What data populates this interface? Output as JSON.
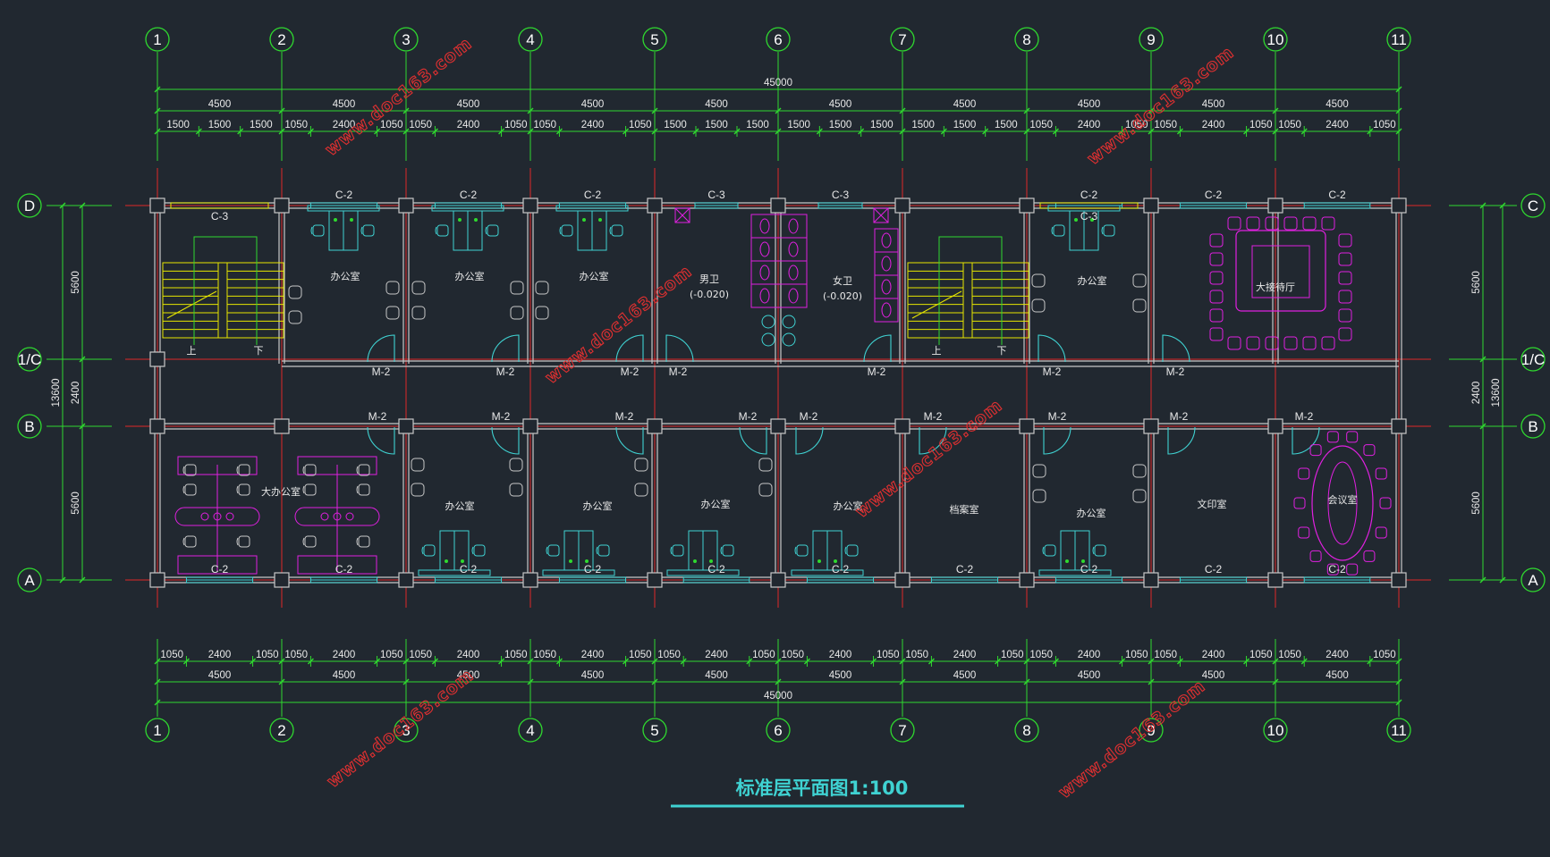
{
  "title": "标准层平面图1:100",
  "watermark": "www.doc163.com",
  "grid_x_labels": [
    "1",
    "2",
    "3",
    "4",
    "5",
    "6",
    "7",
    "8",
    "9",
    "10",
    "11"
  ],
  "grid_y_left": [
    "D",
    "1/C",
    "B",
    "A"
  ],
  "grid_y_right": [
    "C",
    "1/C",
    "B",
    "A"
  ],
  "dims_top_total": "45000",
  "dims_top_bays": [
    "4500",
    "4500",
    "4500",
    "4500",
    "4500",
    "4500",
    "4500",
    "4500",
    "4500",
    "4500"
  ],
  "dims_top_detail": [
    "1500",
    "1500",
    "1500",
    "1050",
    "2400",
    "1050",
    "1050",
    "2400",
    "1050",
    "1050",
    "2400",
    "1050",
    "1500",
    "1500",
    "1500",
    "1500",
    "1500",
    "1500",
    "1500",
    "1500",
    "1500",
    "1050",
    "2400",
    "1050",
    "1050",
    "2400",
    "1050",
    "1050",
    "2400",
    "1050"
  ],
  "dims_bottom_detail": [
    "1050",
    "2400",
    "1050",
    "1050",
    "2400",
    "1050",
    "1050",
    "2400",
    "1050",
    "1050",
    "2400",
    "1050",
    "1050",
    "2400",
    "1050",
    "1050",
    "2400",
    "1050",
    "1050",
    "2400",
    "1050",
    "1050",
    "2400",
    "1050",
    "1050",
    "2400",
    "1050",
    "1050",
    "2400",
    "1050"
  ],
  "dims_bottom_bays": [
    "4500",
    "4500",
    "4500",
    "4500",
    "4500",
    "4500",
    "4500",
    "4500",
    "4500",
    "4500"
  ],
  "dims_bottom_total": "45000",
  "dims_left_parts": [
    "5600",
    "2400",
    "5600"
  ],
  "dims_left_total": "13600",
  "dims_right_parts": [
    "5600",
    "2400",
    "5600"
  ],
  "dims_right_total": "13600",
  "rooms": {
    "office": "办公室",
    "men_wc": "男卫",
    "men_wc_elev": "(-0.020)",
    "women_wc": "女卫",
    "women_wc_elev": "(-0.020)",
    "reception": "大接待厅",
    "open_office": "大办公室",
    "archive": "档案室",
    "print_room": "文印室",
    "meeting": "会议室",
    "stair_up": "上",
    "stair_down": "下"
  },
  "labels": {
    "window_c2": "C-2",
    "window_c3": "C-3",
    "door_m2": "M-2"
  },
  "colors": {
    "background": "#212830",
    "grid_line": "#e02828",
    "dimension": "#2fd92f",
    "wall": "#c8c8c8",
    "window": "#3fd2d2",
    "stair": "#e6e600",
    "furniture_cyan": "#3fd2d2",
    "furniture_magenta": "#e020e0",
    "title": "#3fd2d2",
    "watermark": "#e03030"
  }
}
